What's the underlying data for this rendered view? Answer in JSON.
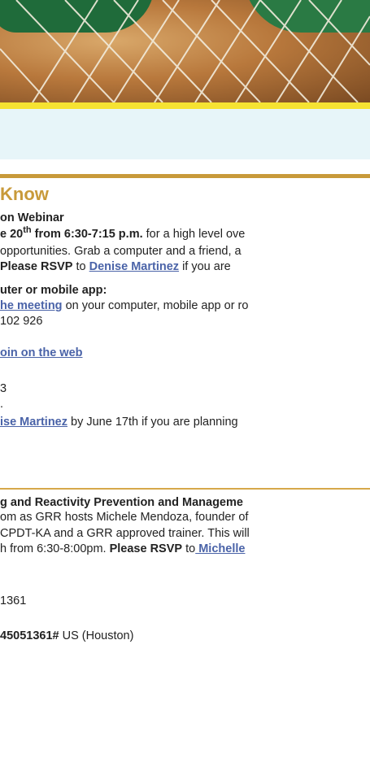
{
  "hero": {
    "image": "dog-with-net-photo"
  },
  "section": {
    "heading": "Know"
  },
  "webinar": {
    "title": "on Webinar",
    "date_a": "e 20",
    "date_sup": "th",
    "date_b": " from 6:30-7:15 p.m.",
    "date_rest": " for a high level ove",
    "line2": " opportunities. Grab a computer and a friend, a",
    "rsvp_label": "Please RSVP",
    "rsvp_to": " to ",
    "rsvp_link": "Denise Martinez",
    "rsvp_tail": " if you are",
    "computer_heading": "uter or mobile app:",
    "meeting_link": "he meeting",
    "meeting_tail": " on your computer, mobile app or ro",
    "meeting_id": "102 926",
    "web_link": "oin on the web",
    "code": "3",
    "dot": ".",
    "rsvp2_link": "ise Martinez",
    "rsvp2_tail": " by June 17th if you are planning"
  },
  "workshop": {
    "title": "g and Reactivity Prevention and Manageme",
    "line1": "om as GRR hosts Michele Mendoza, founder of",
    "line2": "CPDT-KA and a GRR approved trainer. This will",
    "line3_a": "h from 6:30-8:00pm. ",
    "line3_rsvp": "Please RSVP",
    "line3_to": " to",
    "line3_link": " Michelle",
    "phone_id": " 1361",
    "dial_bold": "45051361#",
    "dial_tail": " US (Houston)"
  }
}
